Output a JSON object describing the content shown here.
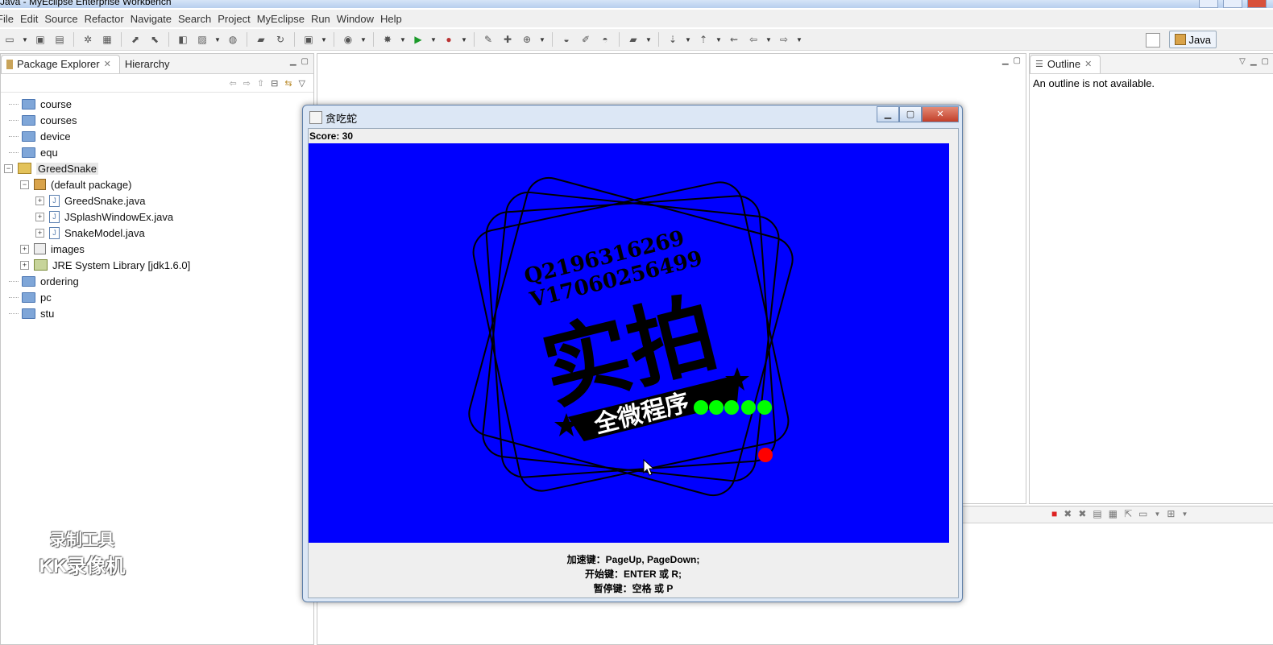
{
  "window": {
    "title": "Java - MyEclipse Enterprise Workbench"
  },
  "menu": [
    "File",
    "Edit",
    "Source",
    "Refactor",
    "Navigate",
    "Search",
    "Project",
    "MyEclipse",
    "Run",
    "Window",
    "Help"
  ],
  "perspective": {
    "label": "Java"
  },
  "package_explorer": {
    "tabs": [
      {
        "label": "Package Explorer"
      },
      {
        "label": "Hierarchy"
      }
    ],
    "tree": [
      {
        "label": "course",
        "kind": "folder",
        "depth": 0
      },
      {
        "label": "courses",
        "kind": "folder",
        "depth": 0
      },
      {
        "label": "device",
        "kind": "folder",
        "depth": 0
      },
      {
        "label": "equ",
        "kind": "folder",
        "depth": 0
      },
      {
        "label": "GreedSnake",
        "kind": "project",
        "depth": 0,
        "expanded": true
      },
      {
        "label": "(default package)",
        "kind": "package",
        "depth": 1,
        "expanded": true
      },
      {
        "label": "GreedSnake.java",
        "kind": "java",
        "depth": 2
      },
      {
        "label": "JSplashWindowEx.java",
        "kind": "java",
        "depth": 2
      },
      {
        "label": "SnakeModel.java",
        "kind": "java",
        "depth": 2
      },
      {
        "label": "images",
        "kind": "package",
        "depth": 1
      },
      {
        "label": "JRE System Library [jdk1.6.0]",
        "kind": "library",
        "depth": 1
      },
      {
        "label": "ordering",
        "kind": "folder",
        "depth": 0
      },
      {
        "label": "pc",
        "kind": "folder",
        "depth": 0
      },
      {
        "label": "stu",
        "kind": "folder",
        "depth": 0
      }
    ]
  },
  "outline": {
    "tab": "Outline",
    "message": "An outline is not available."
  },
  "game": {
    "title": "贪吃蛇",
    "score": "Score: 30",
    "board_color": "#0000fe",
    "snake_color": "#00ff00",
    "food_color": "#ff0000",
    "hints": [
      "加速键：PageUp, PageDown;",
      "开始键：ENTER 或 R;",
      "暂停键：空格 或 P"
    ]
  },
  "stamp": {
    "line1": "Q2196316269",
    "line2": "V17060256499",
    "main": "实拍",
    "banner": "全微程序"
  },
  "watermark": {
    "line1": "录制工具",
    "line2": "KK录像机"
  }
}
